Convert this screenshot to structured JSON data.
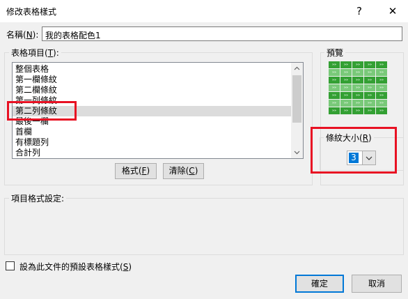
{
  "window": {
    "title": "修改表格樣式",
    "help_glyph": "?",
    "close_glyph": "✕"
  },
  "name_field": {
    "label_pre": "名稱(",
    "label_key": "N",
    "label_post": "):",
    "value": "我的表格配色1"
  },
  "table_element": {
    "label_pre": "表格項目(",
    "label_key": "T",
    "label_post": "):",
    "items": [
      "整個表格",
      "第一欄條紋",
      "第二欄條紋",
      "第一列條紋",
      "第二列條紋",
      "最後一欄",
      "首欄",
      "有標題列",
      "合計列"
    ],
    "selected_index": 4
  },
  "buttons": {
    "format": {
      "pre": "格式(",
      "key": "F",
      "post": ")"
    },
    "clear": {
      "pre": "清除(",
      "key": "C",
      "post": ")"
    },
    "ok": "確定",
    "cancel": "取消"
  },
  "preview": {
    "label": "預覽",
    "rows": 7,
    "cols": 5,
    "cell_glyph": "»»",
    "color_light": "#79c979",
    "color_dark": "#33a033",
    "row_colors": [
      "dark",
      "light",
      "dark",
      "light",
      "dark",
      "light",
      "dark"
    ]
  },
  "stripe_size": {
    "label_pre": "條紋大小(",
    "label_key": "R",
    "label_post": ")",
    "value": "3"
  },
  "element_formatting_label": "項目格式設定:",
  "set_default": {
    "pre": "設為此文件的預設表格樣式(",
    "key": "S",
    "post": ")",
    "checked": false
  },
  "colors": {
    "highlight_red": "#e81123",
    "accent_blue": "#0078d7",
    "selection_gray": "#dcdcdc"
  }
}
